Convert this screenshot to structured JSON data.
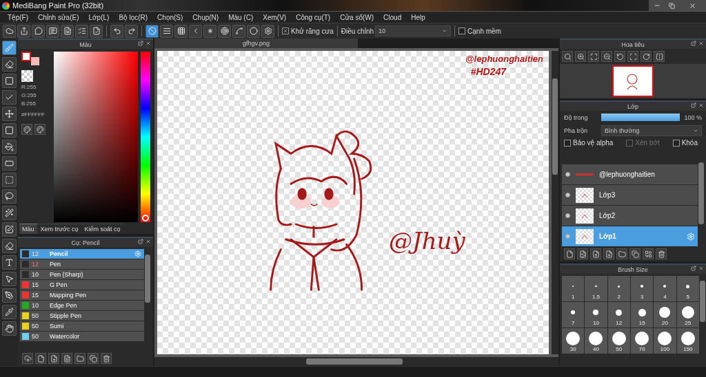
{
  "window": {
    "title": "MediBang Paint Pro (32bit)"
  },
  "menu": [
    "Tệp(F)",
    "Chỉnh sửa(E)",
    "Lớp(L)",
    "Bộ lọc(R)",
    "Chọn(S)",
    "Chụp(N)",
    "Màu (C)",
    "Xem(V)",
    "Công cụ(T)",
    "Cửa sổ(W)",
    "Cloud",
    "Help"
  ],
  "toolbar": {
    "ruler_tools": [
      {
        "selected": true
      },
      {
        "selected": false
      },
      {
        "selected": false
      },
      {
        "selected": false
      },
      {
        "selected": false
      },
      {
        "selected": false
      },
      {
        "selected": false
      },
      {
        "selected": false
      },
      {
        "selected": false
      }
    ],
    "antialias": {
      "label": "Khử răng cưa",
      "checked": true
    },
    "correction": {
      "label": "Điều chỉnh",
      "value": "10"
    },
    "soft_edge": {
      "label": "Cạnh mềm",
      "checked": false
    }
  },
  "tools": [
    {
      "selected": true
    },
    {
      "selected": false
    },
    {
      "selected": false
    },
    {
      "selected": false
    },
    {
      "selected": false
    },
    {
      "selected": false
    },
    {
      "selected": false
    },
    {
      "selected": false
    },
    {
      "selected": false
    },
    {
      "selected": false
    },
    {
      "selected": false
    },
    {
      "selected": false
    },
    {
      "selected": false
    },
    {
      "selected": false
    },
    {
      "selected": false
    },
    {
      "selected": false
    },
    {
      "selected": false
    },
    {
      "selected": false
    }
  ],
  "color_panel": {
    "title": "Màu",
    "hue": {
      "level": 0
    },
    "rgb": [
      "R:255",
      "G:255",
      "B:255"
    ],
    "hex": "#FFFFFF",
    "tabs": [
      {
        "label": "Màu",
        "selected": true
      },
      {
        "label": "Xem trước cọ",
        "selected": false
      },
      {
        "label": "Kiểm soát cọ",
        "selected": false
      }
    ]
  },
  "brush_panel": {
    "title": "Cọ: Pencil",
    "brushes": [
      {
        "color": "#2b2b2b",
        "size": "12",
        "name": "Pencil",
        "selected": true,
        "modified": true
      },
      {
        "color": "#2b2b2b",
        "size": "12",
        "name": "Pen",
        "selected": false,
        "modified": true
      },
      {
        "color": "#2b2b2b",
        "size": "10",
        "name": "Pen (Sharp)",
        "selected": false,
        "modified": false
      },
      {
        "color": "#ee3333",
        "size": "15",
        "name": "G Pen",
        "selected": false,
        "modified": false
      },
      {
        "color": "#ee3333",
        "size": "15",
        "name": "Mapping Pen",
        "selected": false,
        "modified": false
      },
      {
        "color": "#22aa22",
        "size": "10",
        "name": "Edge Pen",
        "selected": false,
        "modified": false
      },
      {
        "color": "#e8d020",
        "size": "50",
        "name": "Stipple Pen",
        "selected": false,
        "modified": false
      },
      {
        "color": "#e8d020",
        "size": "50",
        "name": "Sumi",
        "selected": false,
        "modified": false
      },
      {
        "color": "#6fd0f0",
        "size": "50",
        "name": "Watercolor",
        "selected": false,
        "modified": false
      }
    ]
  },
  "canvas": {
    "tab": "gfhgv.png",
    "texts": [
      "@lephuonghaitien",
      "#HD247"
    ],
    "signature": "@Jhuỳ"
  },
  "navigator": {
    "title": "Hoa tiêu"
  },
  "layer_panel": {
    "title": "Lớp",
    "opacity": {
      "label": "Độ trong",
      "level": 1,
      "reading": "100 %"
    },
    "blend": {
      "label": "Pha trộn",
      "value": "Bình thường"
    },
    "options": [
      {
        "label": "Bảo vệ alpha",
        "checked": false,
        "disabled": false
      },
      {
        "label": "Xén bớt",
        "checked": false,
        "disabled": true
      },
      {
        "label": "Khóa",
        "checked": false,
        "disabled": false
      }
    ],
    "layers": [
      {
        "name": "@lephuonghaitien",
        "kind": "text",
        "visible": true,
        "selected": false
      },
      {
        "name": "Lớp3",
        "kind": "sketch",
        "visible": true,
        "selected": false
      },
      {
        "name": "Lớp2",
        "kind": "sketch",
        "visible": true,
        "selected": false
      },
      {
        "name": "Lớp1",
        "kind": "sketch",
        "visible": true,
        "selected": true
      }
    ]
  },
  "brush_size": {
    "title": "Brush Size",
    "sizes": [
      "1",
      "1.5",
      "2",
      "3",
      "4",
      "5",
      "7",
      "10",
      "12",
      "15",
      "20",
      "25",
      "30",
      "40",
      "50",
      "70",
      "100",
      "150"
    ]
  }
}
